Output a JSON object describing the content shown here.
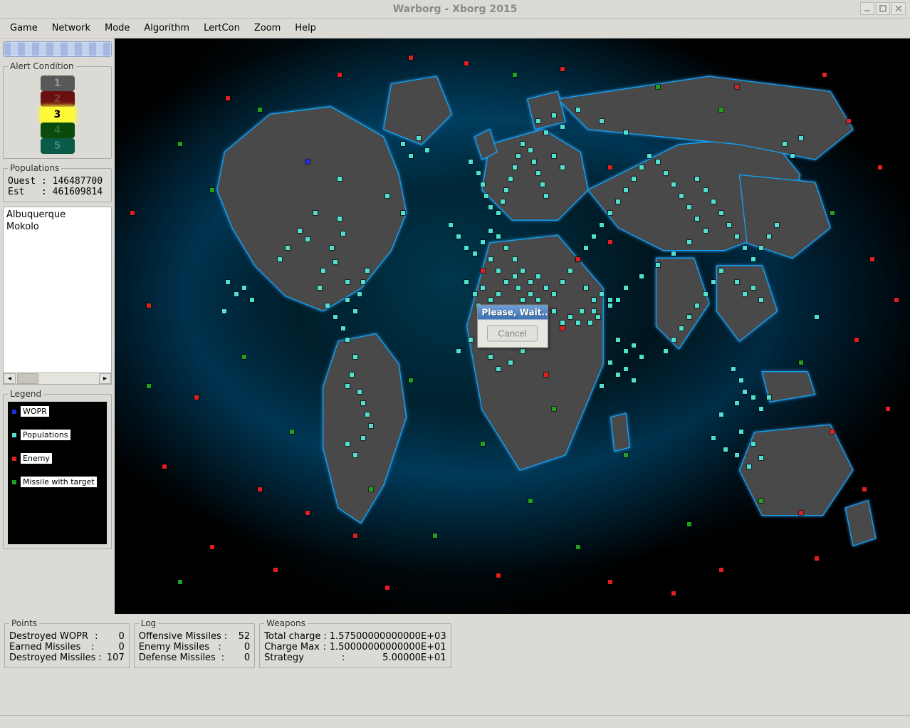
{
  "window": {
    "title": "Warborg - Xborg 2015"
  },
  "menu": [
    "Game",
    "Network",
    "Mode",
    "Algorithm",
    "LertCon",
    "Zoom",
    "Help"
  ],
  "alert": {
    "legend": "Alert Condition",
    "levels": [
      {
        "n": "1",
        "cls": "lamp1"
      },
      {
        "n": "2",
        "cls": "lamp2"
      },
      {
        "n": "3",
        "cls": "lamp3"
      },
      {
        "n": "4",
        "cls": "lamp4"
      },
      {
        "n": "5",
        "cls": "lamp5"
      }
    ],
    "active": 3
  },
  "populations": {
    "legend": "Populations",
    "lines": [
      "Ouest : 146487700",
      "Est   : 461609814"
    ]
  },
  "cities": [
    "Albuquerque",
    "Mokolo"
  ],
  "legendPanel": {
    "legend": "Legend",
    "items": [
      {
        "color": "#2030e0",
        "label": "WOPR"
      },
      {
        "color": "#4fe0d0",
        "label": "Populations"
      },
      {
        "color": "#e02020",
        "label": "Enemy"
      },
      {
        "color": "#20a020",
        "label": "Missile with target"
      }
    ]
  },
  "points": {
    "legend": "Points",
    "rows": [
      {
        "k": "Destroyed WOPR",
        "v": "0"
      },
      {
        "k": "Earned Missiles",
        "v": "0"
      },
      {
        "k": "Destroyed Missiles",
        "v": "107"
      }
    ]
  },
  "log": {
    "legend": "Log",
    "rows": [
      {
        "k": "Offensive Missiles",
        "v": "52"
      },
      {
        "k": "Enemy Missiles",
        "v": "0"
      },
      {
        "k": "Defense Missiles",
        "v": "0"
      }
    ]
  },
  "weapons": {
    "legend": "Weapons",
    "rows": [
      {
        "k": "Total charge",
        "v": "1.57500000000000E+03"
      },
      {
        "k": "Charge Max",
        "v": "1.50000000000000E+01"
      },
      {
        "k": "Strategy",
        "v": "5.00000E+01"
      }
    ]
  },
  "modal": {
    "title": "Please, Wait...",
    "cancel": "Cancel"
  },
  "mapDots": {
    "blue": [
      [
        24,
        21
      ]
    ],
    "teal": [
      [
        20.5,
        38
      ],
      [
        21.5,
        36
      ],
      [
        23,
        33
      ],
      [
        24,
        34.5
      ],
      [
        25,
        30
      ],
      [
        26,
        40
      ],
      [
        27,
        36
      ],
      [
        27.5,
        38.5
      ],
      [
        28,
        31
      ],
      [
        28.5,
        33.5
      ],
      [
        29,
        42
      ],
      [
        29,
        45
      ],
      [
        30,
        47
      ],
      [
        30.5,
        44
      ],
      [
        31,
        42
      ],
      [
        31.5,
        40
      ],
      [
        25.5,
        43
      ],
      [
        26.5,
        46
      ],
      [
        27.5,
        48
      ],
      [
        28.5,
        50
      ],
      [
        29,
        52
      ],
      [
        30,
        55
      ],
      [
        29.5,
        58
      ],
      [
        29,
        60
      ],
      [
        30.5,
        61
      ],
      [
        31,
        63
      ],
      [
        31.5,
        65
      ],
      [
        32,
        67
      ],
      [
        31,
        69
      ],
      [
        29,
        70
      ],
      [
        30,
        72
      ],
      [
        14,
        42
      ],
      [
        15,
        44
      ],
      [
        16,
        43
      ],
      [
        17,
        45
      ],
      [
        13.5,
        47
      ],
      [
        44.5,
        21
      ],
      [
        45.5,
        23
      ],
      [
        46,
        25
      ],
      [
        46.5,
        27
      ],
      [
        47,
        29
      ],
      [
        48,
        30
      ],
      [
        48.5,
        28
      ],
      [
        49,
        26
      ],
      [
        49.5,
        24
      ],
      [
        50,
        22
      ],
      [
        50.5,
        20
      ],
      [
        51,
        18
      ],
      [
        52,
        19
      ],
      [
        52.5,
        21
      ],
      [
        53,
        23
      ],
      [
        53.5,
        25
      ],
      [
        54,
        27
      ],
      [
        55,
        20
      ],
      [
        56,
        22
      ],
      [
        42,
        32
      ],
      [
        43,
        34
      ],
      [
        44,
        36
      ],
      [
        45,
        37
      ],
      [
        46,
        35
      ],
      [
        47,
        33
      ],
      [
        48,
        34
      ],
      [
        49,
        36
      ],
      [
        50,
        38
      ],
      [
        51,
        40
      ],
      [
        52,
        42
      ],
      [
        53,
        41
      ],
      [
        47,
        38
      ],
      [
        48,
        40
      ],
      [
        44,
        42
      ],
      [
        45,
        44
      ],
      [
        46,
        43
      ],
      [
        47,
        45
      ],
      [
        48,
        44
      ],
      [
        49,
        42
      ],
      [
        50,
        41
      ],
      [
        50.5,
        43
      ],
      [
        51,
        45
      ],
      [
        45.5,
        46
      ],
      [
        46.5,
        48
      ],
      [
        47.5,
        47
      ],
      [
        52,
        44
      ],
      [
        53,
        45
      ],
      [
        54,
        43
      ],
      [
        55,
        44
      ],
      [
        56,
        42
      ],
      [
        57,
        40
      ],
      [
        58,
        38
      ],
      [
        59,
        36
      ],
      [
        60,
        34
      ],
      [
        61,
        32
      ],
      [
        62,
        30
      ],
      [
        63,
        28
      ],
      [
        64,
        26
      ],
      [
        65,
        24
      ],
      [
        66,
        22
      ],
      [
        67,
        20
      ],
      [
        68,
        21
      ],
      [
        69,
        23
      ],
      [
        70,
        25
      ],
      [
        71,
        27
      ],
      [
        72,
        29
      ],
      [
        73,
        31
      ],
      [
        74,
        33
      ],
      [
        72,
        35
      ],
      [
        70,
        37
      ],
      [
        68,
        39
      ],
      [
        66,
        41
      ],
      [
        64,
        43
      ],
      [
        62,
        45
      ],
      [
        60,
        47
      ],
      [
        58,
        49
      ],
      [
        47,
        50
      ],
      [
        48,
        52
      ],
      [
        49,
        50
      ],
      [
        50,
        52
      ],
      [
        51,
        54
      ],
      [
        49.5,
        56
      ],
      [
        48,
        57
      ],
      [
        47,
        55
      ],
      [
        46,
        53
      ],
      [
        44.5,
        52
      ],
      [
        43,
        54
      ],
      [
        59,
        43
      ],
      [
        60,
        45
      ],
      [
        61,
        44
      ],
      [
        62,
        46
      ],
      [
        63,
        45
      ],
      [
        58.5,
        47
      ],
      [
        59.5,
        49
      ],
      [
        60.5,
        48
      ],
      [
        55,
        47
      ],
      [
        56,
        49
      ],
      [
        57,
        48
      ],
      [
        73,
        24
      ],
      [
        74,
        26
      ],
      [
        75,
        28
      ],
      [
        76,
        30
      ],
      [
        77,
        32
      ],
      [
        78,
        34
      ],
      [
        79,
        36
      ],
      [
        80,
        38
      ],
      [
        81,
        36
      ],
      [
        82,
        34
      ],
      [
        83,
        32
      ],
      [
        78,
        42
      ],
      [
        79,
        44
      ],
      [
        80,
        43
      ],
      [
        81,
        45
      ],
      [
        76,
        40
      ],
      [
        75,
        42
      ],
      [
        74,
        44
      ],
      [
        73,
        46
      ],
      [
        72,
        48
      ],
      [
        71,
        50
      ],
      [
        70,
        52
      ],
      [
        69,
        54
      ],
      [
        63,
        52
      ],
      [
        64,
        54
      ],
      [
        65,
        53
      ],
      [
        66,
        55
      ],
      [
        62,
        56
      ],
      [
        63,
        58
      ],
      [
        64,
        57
      ],
      [
        65,
        59
      ],
      [
        61,
        60
      ],
      [
        77.5,
        57
      ],
      [
        78.5,
        59
      ],
      [
        79,
        61
      ],
      [
        80,
        62
      ],
      [
        81,
        64
      ],
      [
        82,
        62
      ],
      [
        78,
        63
      ],
      [
        76,
        65
      ],
      [
        75,
        69
      ],
      [
        76.5,
        71
      ],
      [
        78,
        72
      ],
      [
        79.5,
        74
      ],
      [
        81,
        72.5
      ],
      [
        80,
        70
      ],
      [
        78.5,
        68
      ],
      [
        36,
        18
      ],
      [
        37,
        20
      ],
      [
        38,
        17
      ],
      [
        39,
        19
      ],
      [
        53,
        14
      ],
      [
        54,
        16
      ],
      [
        55,
        13
      ],
      [
        56,
        15
      ],
      [
        84,
        18
      ],
      [
        85,
        20
      ],
      [
        86,
        17
      ],
      [
        28,
        24
      ],
      [
        34,
        27
      ],
      [
        36,
        30
      ],
      [
        58,
        12
      ],
      [
        61,
        14
      ],
      [
        64,
        16
      ],
      [
        88,
        48
      ]
    ],
    "red": [
      [
        14,
        10
      ],
      [
        28,
        6
      ],
      [
        37,
        3
      ],
      [
        44,
        4
      ],
      [
        56,
        5
      ],
      [
        78,
        8
      ],
      [
        89,
        6
      ],
      [
        92,
        14
      ],
      [
        96,
        22
      ],
      [
        95,
        38
      ],
      [
        98,
        45
      ],
      [
        10,
        62
      ],
      [
        6,
        74
      ],
      [
        12,
        88
      ],
      [
        20,
        92
      ],
      [
        34,
        95
      ],
      [
        48,
        93
      ],
      [
        62,
        94
      ],
      [
        76,
        92
      ],
      [
        88,
        90
      ],
      [
        94,
        78
      ],
      [
        97,
        64
      ],
      [
        4,
        46
      ],
      [
        2,
        30
      ],
      [
        46,
        40
      ],
      [
        58,
        38
      ],
      [
        62,
        35
      ],
      [
        56,
        50
      ],
      [
        18,
        78
      ],
      [
        24,
        82
      ],
      [
        30,
        86
      ],
      [
        93,
        52
      ],
      [
        90,
        68
      ],
      [
        86,
        82
      ],
      [
        70,
        96
      ],
      [
        54,
        58
      ],
      [
        62,
        22
      ]
    ],
    "green": [
      [
        8,
        18
      ],
      [
        12,
        26
      ],
      [
        16,
        55
      ],
      [
        22,
        68
      ],
      [
        32,
        78
      ],
      [
        40,
        86
      ],
      [
        52,
        80
      ],
      [
        58,
        88
      ],
      [
        46,
        70
      ],
      [
        37,
        59
      ],
      [
        55,
        64
      ],
      [
        64,
        72
      ],
      [
        72,
        84
      ],
      [
        81,
        80
      ],
      [
        86,
        56
      ],
      [
        90,
        30
      ],
      [
        76,
        12
      ],
      [
        68,
        8
      ],
      [
        50,
        6
      ],
      [
        18,
        12
      ],
      [
        4,
        60
      ],
      [
        8,
        94
      ]
    ]
  }
}
